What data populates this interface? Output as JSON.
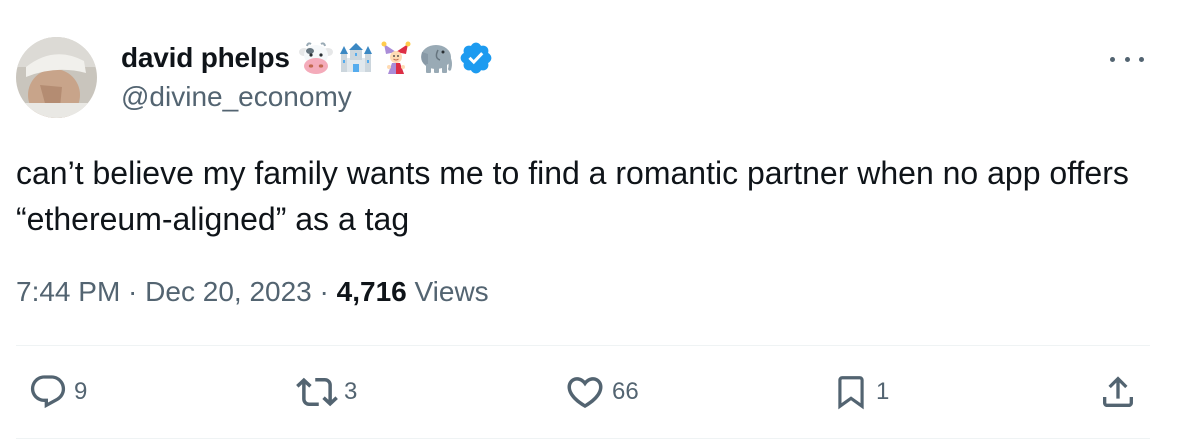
{
  "author": {
    "display_name": "david phelps",
    "handle": "@divine_economy",
    "name_emojis": [
      "cow-face-icon",
      "castle-icon",
      "jester-icon",
      "elephant-icon"
    ],
    "verified": true
  },
  "tweet": {
    "text": "can’t believe my family wants me to find a romantic partner when no app offers “ethereum-aligned” as a tag",
    "time": "7:44 PM",
    "separator1": " · ",
    "date": "Dec 20, 2023",
    "separator2": " · ",
    "views_count": "4,716",
    "views_label": " Views"
  },
  "actions": {
    "replies": "9",
    "retweets": "3",
    "likes": "66",
    "bookmarks": "1"
  },
  "colors": {
    "verified_badge": "#1d9bf0",
    "secondary_text": "#536471",
    "primary_text": "#0f1419"
  }
}
